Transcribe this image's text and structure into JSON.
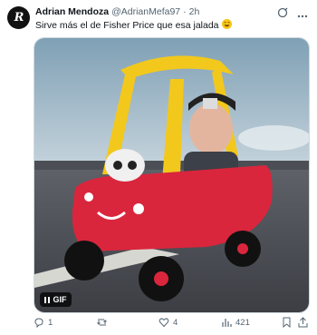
{
  "tweet": {
    "author_name": "Adrian Mendoza",
    "author_handle": "@AdrianMefa97",
    "separator": "·",
    "time": "2h",
    "text": "Sirve más el de Fisher Price que esa jalada",
    "text_emoji": "rolling-on-floor-laughing-emoji",
    "avatar_text": "R"
  },
  "media": {
    "badge_label": "GIF",
    "description_icons": [
      "pause-icon"
    ]
  },
  "actions": {
    "reply_count": "1",
    "retweet_count": "",
    "like_count": "4",
    "views_count": "421"
  },
  "colors": {
    "text": "#0f1419",
    "secondary": "#536471",
    "car_red": "#d9263d",
    "car_yellow": "#f2c81c"
  }
}
